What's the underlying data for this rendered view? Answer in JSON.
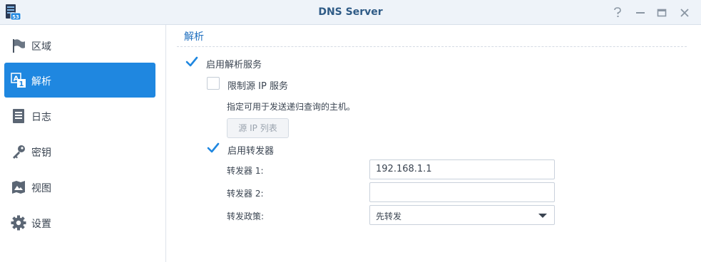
{
  "window": {
    "title": "DNS Server",
    "app_icon_badge": "53",
    "controls": [
      "help-icon",
      "minimize-icon",
      "maximize-icon",
      "close-icon"
    ]
  },
  "sidebar": {
    "items": [
      {
        "label": "区域",
        "icon": "flag-icon",
        "active": false
      },
      {
        "label": "解析",
        "icon": "resolution-icon",
        "active": true
      },
      {
        "label": "日志",
        "icon": "log-icon",
        "active": false
      },
      {
        "label": "密钥",
        "icon": "key-icon",
        "active": false
      },
      {
        "label": "视图",
        "icon": "view-icon",
        "active": false
      },
      {
        "label": "设置",
        "icon": "gear-icon",
        "active": false
      }
    ]
  },
  "main": {
    "section_title": "解析",
    "enable_resolution": {
      "label": "启用解析服务",
      "checked": true
    },
    "limit_source_ip": {
      "label": "限制源 IP 服务",
      "checked": false
    },
    "hint": "指定可用于发送递归查询的主机。",
    "source_ip_list_button": "源 IP 列表",
    "enable_forwarder": {
      "label": "启用转发器",
      "checked": true
    },
    "forwarder1": {
      "label": "转发器 1:",
      "value": "192.168.1.1"
    },
    "forwarder2": {
      "label": "转发器 2:",
      "value": ""
    },
    "forward_policy": {
      "label": "转发政策:",
      "value": "先转发"
    }
  },
  "colors": {
    "accent": "#1f87e0",
    "title_text": "#2f5b86",
    "section_title": "#1f6fbf",
    "checkmark": "#1f87e0"
  }
}
